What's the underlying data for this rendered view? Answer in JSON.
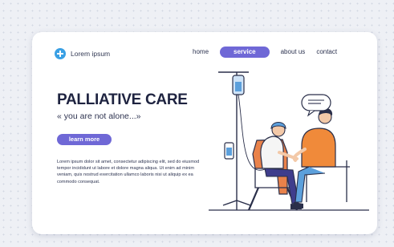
{
  "brand": {
    "name": "Lorem ipsum",
    "icon": "medical-cross-icon"
  },
  "nav": {
    "items": [
      "home",
      "service",
      "about us",
      "contact"
    ],
    "active": "service"
  },
  "hero": {
    "title": "PALLIATIVE CARE",
    "subtitle": "« you are not alone...»",
    "cta": "learn more",
    "body": "Lorem ipsum dolor sit amet, consectetur adipiscing elit, sed do eiusmod tempor incididunt ut labore et dolore magna aliqua. Ut enim ad minim veniam, quis nostrud exercitation ullamco laboris nisi ut aliquip ex ea commodo consequat."
  },
  "illustration": {
    "icon": "iv-drip-patient-illustration"
  },
  "colors": {
    "accent": "#6f68d6",
    "brand_icon": "#3aa0e4",
    "chair": "#e9824a",
    "shirt": "#f08a3a",
    "headscarf": "#5ca0dc"
  }
}
